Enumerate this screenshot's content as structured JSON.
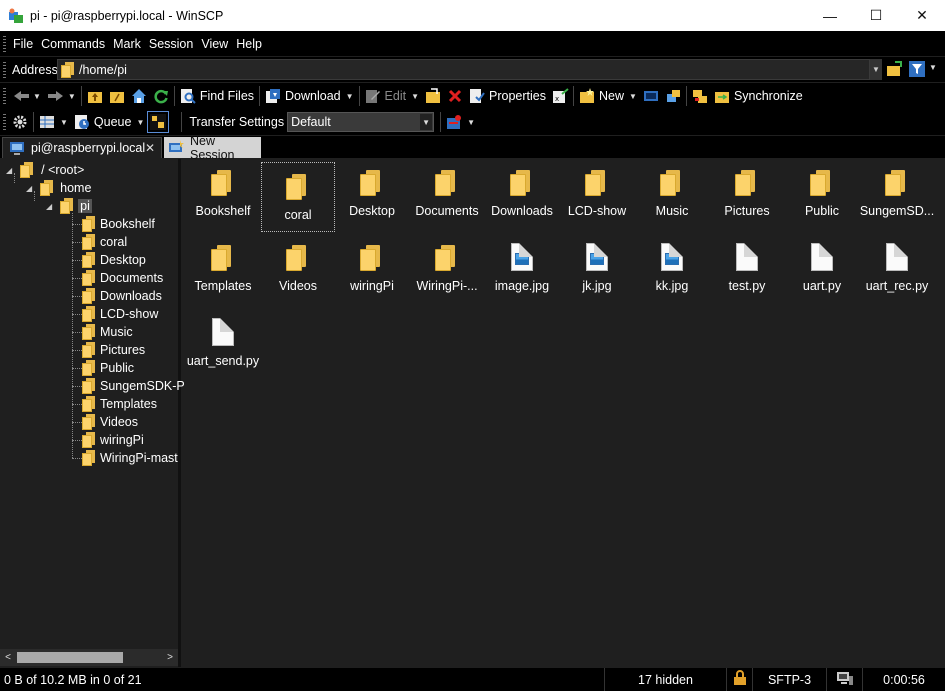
{
  "window": {
    "title": "pi - pi@raspberrypi.local - WinSCP",
    "minimize": "—",
    "maximize": "☐",
    "close": "✕"
  },
  "menu": [
    "File",
    "Commands",
    "Mark",
    "Session",
    "View",
    "Help"
  ],
  "address": {
    "label": "Address",
    "value": "/home/pi"
  },
  "toolbar1": {
    "find_files": "Find Files",
    "download": "Download",
    "edit": "Edit",
    "properties": "Properties",
    "new": "New",
    "synchronize": "Synchronize"
  },
  "toolbar2": {
    "queue": "Queue",
    "transfer_settings_label": "Transfer Settings",
    "transfer_settings_value": "Default"
  },
  "tabs": {
    "active": "pi@raspberrypi.local",
    "new_session": "New Session"
  },
  "tree": {
    "root": "/ <root>",
    "home": "home",
    "pi": "pi",
    "children": [
      "Bookshelf",
      "coral",
      "Desktop",
      "Documents",
      "Downloads",
      "LCD-show",
      "Music",
      "Pictures",
      "Public",
      "SungemSDK-P",
      "Templates",
      "Videos",
      "wiringPi",
      "WiringPi-mast"
    ]
  },
  "files": [
    {
      "name": "Bookshelf",
      "type": "folder"
    },
    {
      "name": "coral",
      "type": "folder"
    },
    {
      "name": "Desktop",
      "type": "folder"
    },
    {
      "name": "Documents",
      "type": "folder"
    },
    {
      "name": "Downloads",
      "type": "folder"
    },
    {
      "name": "LCD-show",
      "type": "folder"
    },
    {
      "name": "Music",
      "type": "folder"
    },
    {
      "name": "Pictures",
      "type": "folder"
    },
    {
      "name": "Public",
      "type": "folder"
    },
    {
      "name": "SungemSD...",
      "type": "folder"
    },
    {
      "name": "Templates",
      "type": "folder"
    },
    {
      "name": "Videos",
      "type": "folder"
    },
    {
      "name": "wiringPi",
      "type": "folder"
    },
    {
      "name": "WiringPi-...",
      "type": "folder"
    },
    {
      "name": "image.jpg",
      "type": "image"
    },
    {
      "name": "jk.jpg",
      "type": "image"
    },
    {
      "name": "kk.jpg",
      "type": "image"
    },
    {
      "name": "test.py",
      "type": "file"
    },
    {
      "name": "uart.py",
      "type": "file"
    },
    {
      "name": "uart_rec.py",
      "type": "file"
    },
    {
      "name": "uart_send.py",
      "type": "file"
    }
  ],
  "status": {
    "selection": "0 B of 10.2 MB in 0 of 21",
    "hidden": "17 hidden",
    "protocol": "SFTP-3",
    "elapsed": "0:00:56"
  },
  "colors": {
    "folder": "#fcd36b",
    "background": "#1f1f1f",
    "bar": "#000000"
  }
}
